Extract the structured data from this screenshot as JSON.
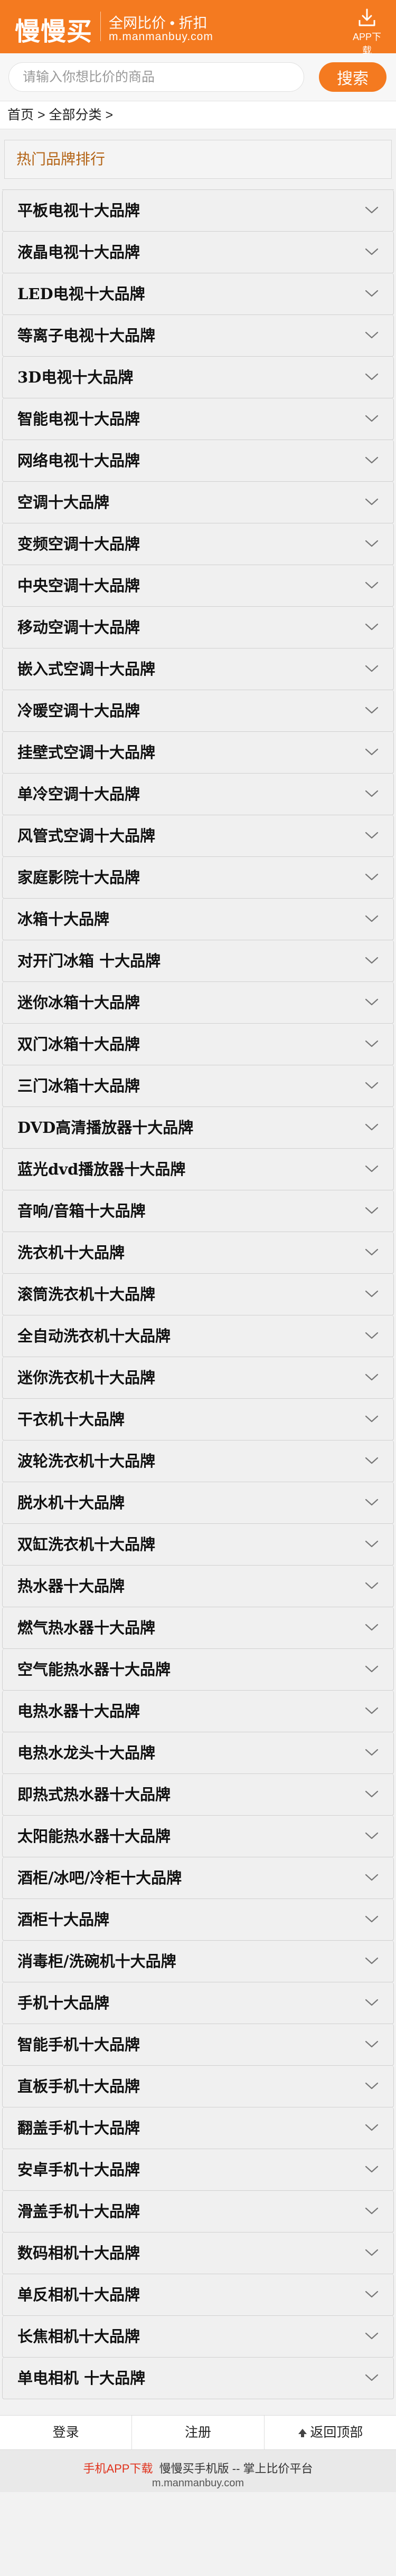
{
  "header": {
    "logo": "慢慢买",
    "slogan": "全网比价 • 折扣",
    "domain": "m.manmanbuy.com",
    "app_download": "APP下载"
  },
  "search": {
    "placeholder": "请输入你想比价的商品",
    "value": "",
    "button": "搜索"
  },
  "breadcrumb": {
    "home": "首页",
    "sep": ">",
    "all": "全部分类",
    "trail": ">"
  },
  "section_title": "热门品牌排行",
  "categories": [
    "平板电视十大品牌",
    "液晶电视十大品牌",
    "LED电视十大品牌",
    "等离子电视十大品牌",
    "3D电视十大品牌",
    "智能电视十大品牌",
    "网络电视十大品牌",
    "空调十大品牌",
    "变频空调十大品牌",
    "中央空调十大品牌",
    "移动空调十大品牌",
    "嵌入式空调十大品牌",
    "冷暖空调十大品牌",
    "挂壁式空调十大品牌",
    "单冷空调十大品牌",
    "风管式空调十大品牌",
    "家庭影院十大品牌",
    "冰箱十大品牌",
    "对开门冰箱 十大品牌",
    "迷你冰箱十大品牌",
    "双门冰箱十大品牌",
    "三门冰箱十大品牌",
    "DVD高清播放器十大品牌",
    "蓝光dvd播放器十大品牌",
    "音响/音箱十大品牌",
    "洗衣机十大品牌",
    "滚筒洗衣机十大品牌",
    "全自动洗衣机十大品牌",
    "迷你洗衣机十大品牌",
    "干衣机十大品牌",
    "波轮洗衣机十大品牌",
    "脱水机十大品牌",
    "双缸洗衣机十大品牌",
    "热水器十大品牌",
    "燃气热水器十大品牌",
    "空气能热水器十大品牌",
    "电热水器十大品牌",
    "电热水龙头十大品牌",
    "即热式热水器十大品牌",
    "太阳能热水器十大品牌",
    "酒柜/冰吧/冷柜十大品牌",
    "酒柜十大品牌",
    "消毒柜/洗碗机十大品牌",
    "手机十大品牌",
    "智能手机十大品牌",
    "直板手机十大品牌",
    "翻盖手机十大品牌",
    "安卓手机十大品牌",
    "滑盖手机十大品牌",
    "数码相机十大品牌",
    "单反相机十大品牌",
    "长焦相机十大品牌",
    "单电相机 十大品牌"
  ],
  "footer_nav": {
    "login": "登录",
    "register": "注册",
    "back_top": "返回顶部"
  },
  "footer_info": {
    "app_link": "手机APP下载",
    "mobile_site": "慢慢买手机版",
    "sep": "--",
    "tagline": "掌上比价平台",
    "domain": "m.manmanbuy.com"
  },
  "colors": {
    "brand": "#f47a20",
    "section_title_text": "#b36315",
    "app_link": "#e0331d"
  }
}
